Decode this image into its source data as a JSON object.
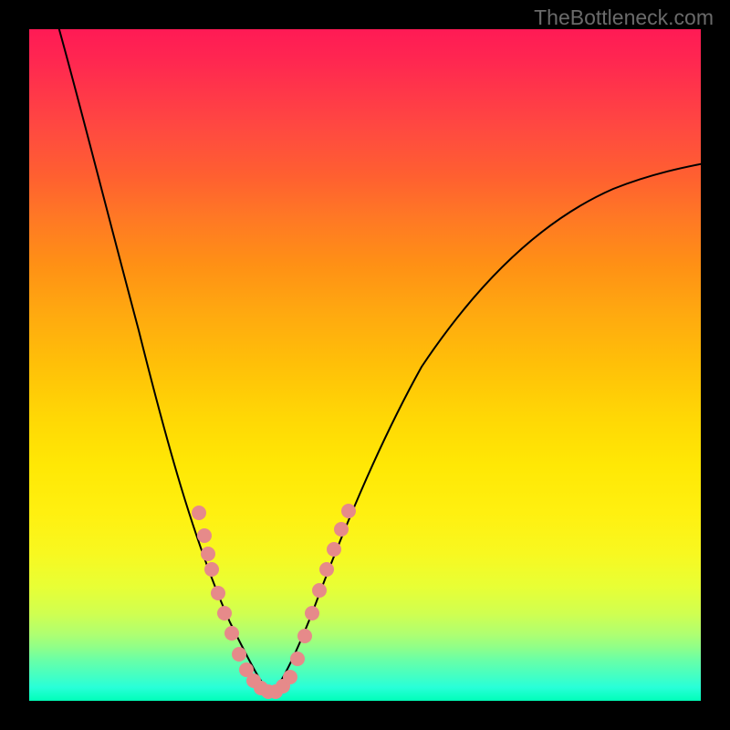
{
  "watermark": "TheBottleneck.com",
  "chart_data": {
    "type": "line",
    "title": "",
    "xlabel": "",
    "ylabel": "",
    "xlim": [
      0,
      100
    ],
    "ylim": [
      0,
      100
    ],
    "curve": {
      "left_branch": [
        {
          "x": 5,
          "y": 100
        },
        {
          "x": 8,
          "y": 90
        },
        {
          "x": 12,
          "y": 75
        },
        {
          "x": 16,
          "y": 60
        },
        {
          "x": 20,
          "y": 45
        },
        {
          "x": 23,
          "y": 33
        },
        {
          "x": 26,
          "y": 22
        },
        {
          "x": 29,
          "y": 12
        },
        {
          "x": 32,
          "y": 5
        },
        {
          "x": 35,
          "y": 1
        }
      ],
      "right_branch": [
        {
          "x": 35,
          "y": 1
        },
        {
          "x": 38,
          "y": 5
        },
        {
          "x": 42,
          "y": 15
        },
        {
          "x": 47,
          "y": 28
        },
        {
          "x": 53,
          "y": 40
        },
        {
          "x": 60,
          "y": 52
        },
        {
          "x": 68,
          "y": 62
        },
        {
          "x": 76,
          "y": 70
        },
        {
          "x": 85,
          "y": 75
        },
        {
          "x": 95,
          "y": 79
        },
        {
          "x": 100,
          "y": 80
        }
      ]
    },
    "scatter_points": [
      {
        "x": 25,
        "y": 28
      },
      {
        "x": 26,
        "y": 24
      },
      {
        "x": 26.5,
        "y": 21
      },
      {
        "x": 27,
        "y": 19
      },
      {
        "x": 28,
        "y": 15
      },
      {
        "x": 29,
        "y": 12
      },
      {
        "x": 30,
        "y": 9
      },
      {
        "x": 31,
        "y": 6
      },
      {
        "x": 32,
        "y": 4
      },
      {
        "x": 33,
        "y": 2.5
      },
      {
        "x": 34,
        "y": 1.5
      },
      {
        "x": 35,
        "y": 1
      },
      {
        "x": 36,
        "y": 1.5
      },
      {
        "x": 37,
        "y": 2.5
      },
      {
        "x": 38,
        "y": 4
      },
      {
        "x": 39,
        "y": 7
      },
      {
        "x": 40,
        "y": 10
      },
      {
        "x": 41,
        "y": 13
      },
      {
        "x": 42,
        "y": 16
      },
      {
        "x": 43,
        "y": 19
      },
      {
        "x": 44,
        "y": 22
      },
      {
        "x": 45,
        "y": 25
      },
      {
        "x": 46,
        "y": 28
      }
    ],
    "dot_color": "#e68a8a",
    "curve_color": "#000000"
  }
}
